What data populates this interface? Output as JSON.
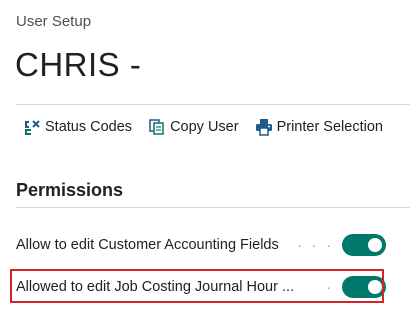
{
  "page": {
    "type_label": "User Setup",
    "title": "CHRIS -"
  },
  "actions": [
    {
      "label": "Status Codes",
      "icon": "status-codes-icon"
    },
    {
      "label": "Copy User",
      "icon": "copy-icon"
    },
    {
      "label": "Printer Selection",
      "icon": "printer-icon"
    }
  ],
  "permissions": {
    "section_title": "Permissions",
    "fields": [
      {
        "label": "Allow to edit Customer Accounting Fields",
        "dots": "· · ·",
        "value": true
      },
      {
        "label": "Allowed to edit Job Costing Journal Hour ...",
        "dots": "·",
        "value": true
      }
    ]
  },
  "colors": {
    "toggle_on": "#00796b",
    "icon_teal": "#00796b",
    "icon_blue": "#1f5a8a",
    "highlight": "#d3232a"
  }
}
